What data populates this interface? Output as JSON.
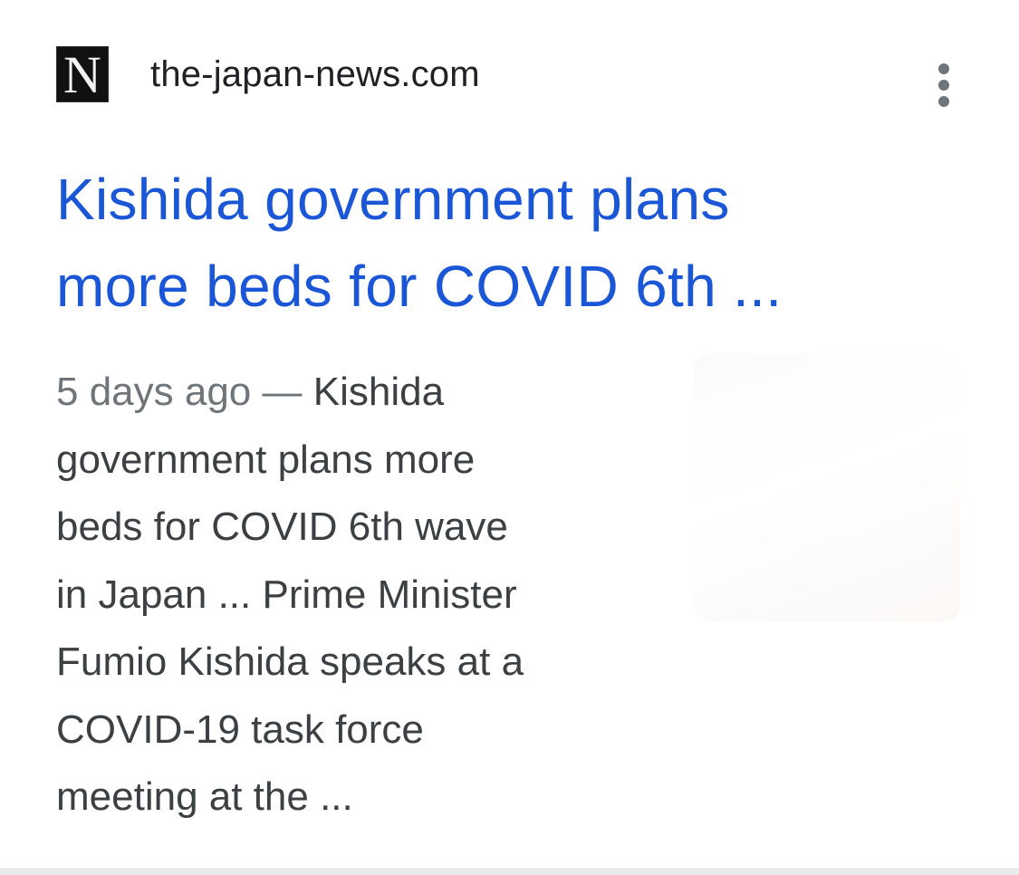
{
  "result": {
    "favicon_letter": "N",
    "source": "the-japan-news.com",
    "more_icon": "more-vert-icon",
    "title_lines": [
      "Kishida government plans",
      "more beds for COVID 6th ..."
    ],
    "date": "5 days ago",
    "date_separator": " — ",
    "snippet_lines": [
      "Kishida",
      "government plans more",
      "beds for COVID 6th wave",
      "in Japan ... Prime Minister",
      "Fumio Kishida speaks at a",
      "COVID-19 task force",
      "meeting at the ..."
    ]
  },
  "colors": {
    "title": "#1a56d6",
    "snippet": "#3c4043",
    "date": "#70757a"
  }
}
